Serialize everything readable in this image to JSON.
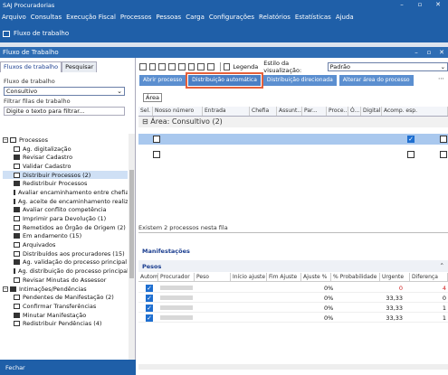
{
  "app": {
    "title": "SAJ Procuradorias"
  },
  "menu": [
    "Arquivo",
    "Consultas",
    "Execução Fiscal",
    "Processos",
    "Pessoas",
    "Carga",
    "Configurações",
    "Relatórios",
    "Estatísticas",
    "Ajuda"
  ],
  "shortcut": {
    "label": "Fluxo de trabalho"
  },
  "window": {
    "title": "Fluxo de Trabalho"
  },
  "left": {
    "tabs": [
      "Fluxos de trabalho",
      "Pesquisar"
    ],
    "flow_label": "Fluxo de trabalho",
    "flow_value": "Consultivo",
    "filter_label": "Filtrar filas de trabalho",
    "filter_placeholder": "Digite o texto para filtrar...",
    "tree": [
      {
        "label": "Processos",
        "group": true
      },
      {
        "label": "Ag. digitalização"
      },
      {
        "label": "Revisar Cadastro"
      },
      {
        "label": "Validar Cadastro"
      },
      {
        "label": "Distribuir Processos (2)",
        "selected": true
      },
      {
        "label": "Redistribuir Processos"
      },
      {
        "label": "Avaliar encaminhamento entre chefias"
      },
      {
        "label": "Ag. aceite de encaminhamento realizado"
      },
      {
        "label": "Avaliar conflito competência"
      },
      {
        "label": "Imprimir para Devolução (1)"
      },
      {
        "label": "Remetidos ao Órgão de Origem (2)"
      },
      {
        "label": "Em andamento (15)"
      },
      {
        "label": "Arquivados"
      },
      {
        "label": "Distribuídos aos procuradores (15)"
      },
      {
        "label": "Ag. validação do processo principal"
      },
      {
        "label": "Ag. distribuição do processo principal"
      },
      {
        "label": "Revisar Minutas do Assessor"
      },
      {
        "label": "Intimações/Pendências",
        "group": true
      },
      {
        "label": "Pendentes de Manifestação (2)"
      },
      {
        "label": "Confirmar Transferências"
      },
      {
        "label": "Minutar Manifestação"
      },
      {
        "label": "Redistribuir Pendências (4)"
      }
    ],
    "close_label": "Fechar"
  },
  "right": {
    "legenda": "Legenda",
    "estilo_label": "Estilo da visualização:",
    "estilo_value": "Padrão",
    "actions": [
      "Abrir processo",
      "Distribuição automática",
      "Distribuição direcionada",
      "Alterar área do processo"
    ],
    "group_chip": "Área",
    "columns": [
      "Sel.",
      "Nosso número",
      "Entrada",
      "Chefia",
      "Assunt...",
      "Par...",
      "Proce...",
      "Ó...",
      "Digital",
      "Acomp. esp."
    ],
    "group_title": "Área: Consultivo",
    "group_count": "(2)",
    "status": "Existem 2 processos nesta fila",
    "manifestacoes": "Manifestações",
    "pesos": "Pesos",
    "pesos_columns": [
      "Autom.",
      "Procurador",
      "Peso",
      "Início ajuste",
      "Fim Ajuste",
      "Ajuste %",
      "% Probabilidade",
      "Urgente",
      "Diferença"
    ],
    "pesos_rows": [
      {
        "ajuste": "0%",
        "prob": "0",
        "urg": "0",
        "dif": "4",
        "red": true
      },
      {
        "ajuste": "0%",
        "prob": "33,33",
        "urg": "0",
        "dif": "0"
      },
      {
        "ajuste": "0%",
        "prob": "33,33",
        "urg": "0",
        "dif": "1"
      },
      {
        "ajuste": "0%",
        "prob": "33,33",
        "urg": "0",
        "dif": "1"
      }
    ]
  }
}
